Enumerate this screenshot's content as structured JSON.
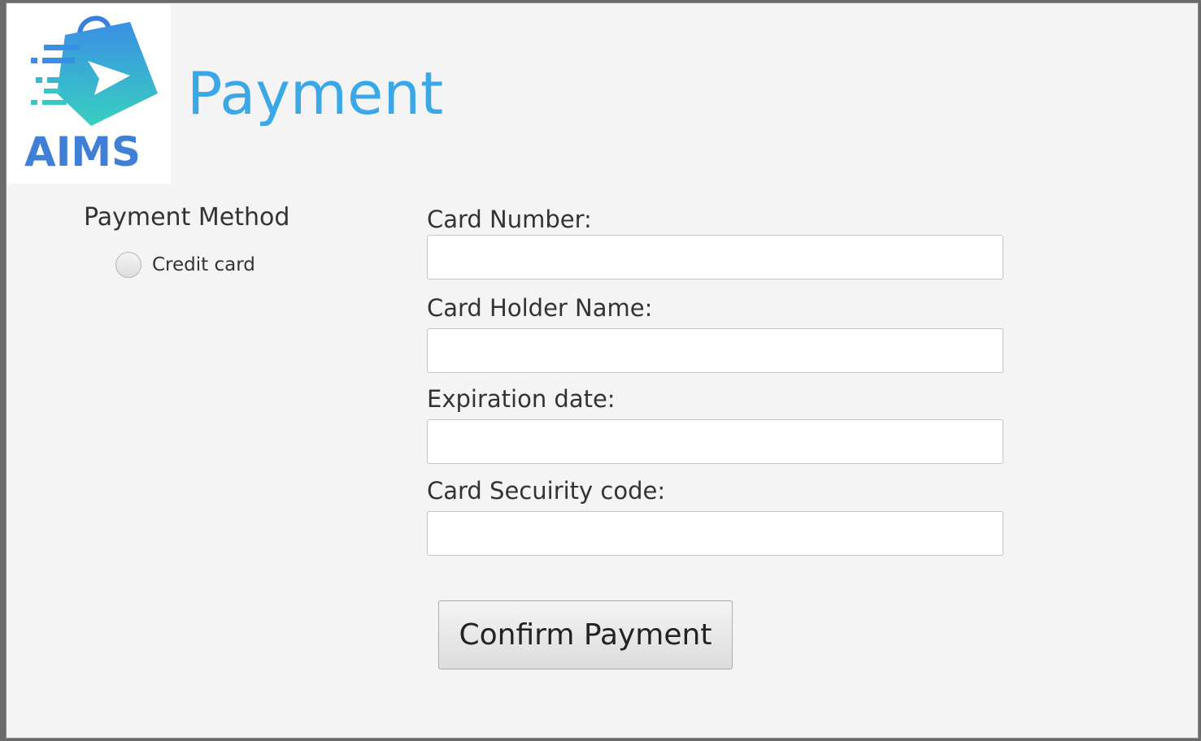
{
  "logo": {
    "text": "AIMS",
    "icon": "shopping-bag-play-logo",
    "colors": {
      "bag_top": "#3a8fe4",
      "bag_bottom": "#38d0c0",
      "text": "#3f7fd6"
    }
  },
  "header": {
    "title": "Payment",
    "title_color": "#3aa7e6"
  },
  "payment_method": {
    "label": "Payment Method",
    "options": [
      {
        "label": "Credit card",
        "selected": false
      }
    ]
  },
  "form": {
    "fields": [
      {
        "label": "Card Number:",
        "value": ""
      },
      {
        "label": "Card Holder Name:",
        "value": ""
      },
      {
        "label": "Expiration date:",
        "value": ""
      },
      {
        "label": "Card Secuirity code:",
        "value": ""
      }
    ],
    "confirm_label": "Confirm Payment"
  }
}
